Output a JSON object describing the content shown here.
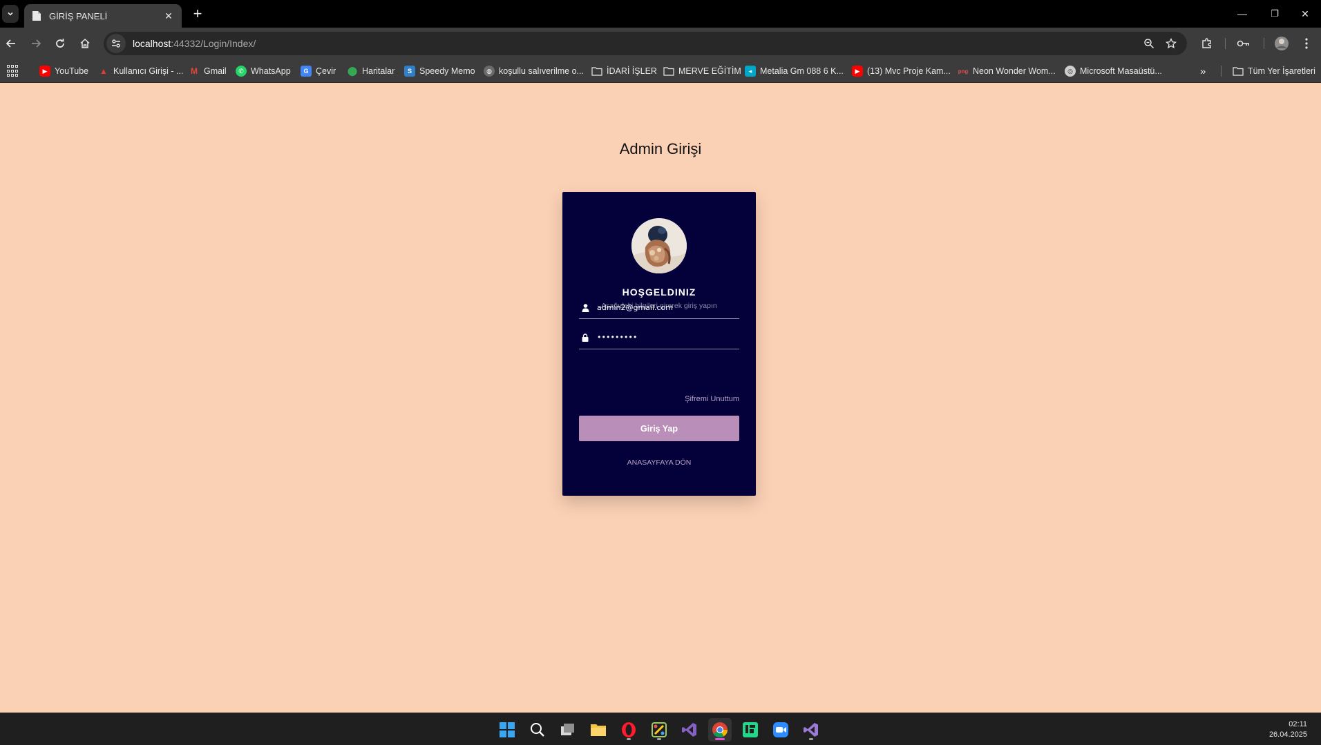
{
  "browser": {
    "tab_title": "GİRİŞ PANELİ",
    "tab_close": "✕",
    "new_tab": "+",
    "url_host": "localhost",
    "url_path": ":44332/Login/Index/",
    "window_controls": [
      "—",
      "❐",
      "✕"
    ]
  },
  "bookmarks": [
    {
      "label": "YouTube",
      "icon": "youtube-icon",
      "color": "#ff0000"
    },
    {
      "label": "Kullanıcı Girişi - ...",
      "icon": "user-login-icon",
      "color": "#e53935"
    },
    {
      "label": "Gmail",
      "icon": "gmail-icon",
      "color": "#ea4335"
    },
    {
      "label": "WhatsApp",
      "icon": "whatsapp-icon",
      "color": "#25d366"
    },
    {
      "label": "Çevir",
      "icon": "translate-icon",
      "color": "#4285f4"
    },
    {
      "label": "Haritalar",
      "icon": "maps-icon",
      "color": "#34a853"
    },
    {
      "label": "Speedy Memo",
      "icon": "speedy-memo-icon",
      "color": "#2f80c8"
    },
    {
      "label": "koşullu salıverilme o...",
      "icon": "globe-icon",
      "color": "#9e9e9e"
    },
    {
      "label": "İDARİ İŞLER",
      "icon": "folder-icon",
      "color": "#e8e8e8"
    },
    {
      "label": "MERVE EĞİTİM",
      "icon": "folder-icon",
      "color": "#e8e8e8"
    },
    {
      "label": "Metalia Gm 088 6 K...",
      "icon": "metalia-icon",
      "color": "#00a8c8"
    },
    {
      "label": "(13) Mvc Proje Kam...",
      "icon": "youtube-icon",
      "color": "#ff0000"
    },
    {
      "label": "Neon Wonder Wom...",
      "icon": "png-icon",
      "color": "#d9534f"
    },
    {
      "label": "Microsoft Masaüstü...",
      "icon": "microsoft-icon",
      "color": "#cfcfcf"
    }
  ],
  "bookmarks_overflow": "»",
  "all_bookmarks": "Tüm Yer İşaretleri",
  "login": {
    "page_title": "Admin Girişi",
    "welcome": "HOŞGELDINIZ",
    "subtitle": "Aşağıdaki bilgileri girerek giriş yapın",
    "email_value": "admin2@gmail.com",
    "password_value": "•••••••••",
    "forgot_label": "Şifremi Unuttum",
    "submit_label": "Giriş Yap",
    "home_label": "ANASAYFAYA DÖN",
    "colors": {
      "page_bg": "#fbd1b5",
      "card_bg": "#03003a",
      "button_bg": "#b98fb9",
      "link": "#b9a3c8"
    }
  },
  "taskbar": {
    "apps": [
      "start-icon",
      "search-icon",
      "task-view-icon",
      "file-explorer-icon",
      "opera-icon",
      "paint-icon",
      "visual-studio-icon",
      "chrome-icon",
      "jetbrains-icon",
      "zoom-icon",
      "visual-studio-preview-icon"
    ],
    "time": "02:11",
    "date": "26.04.2025"
  }
}
